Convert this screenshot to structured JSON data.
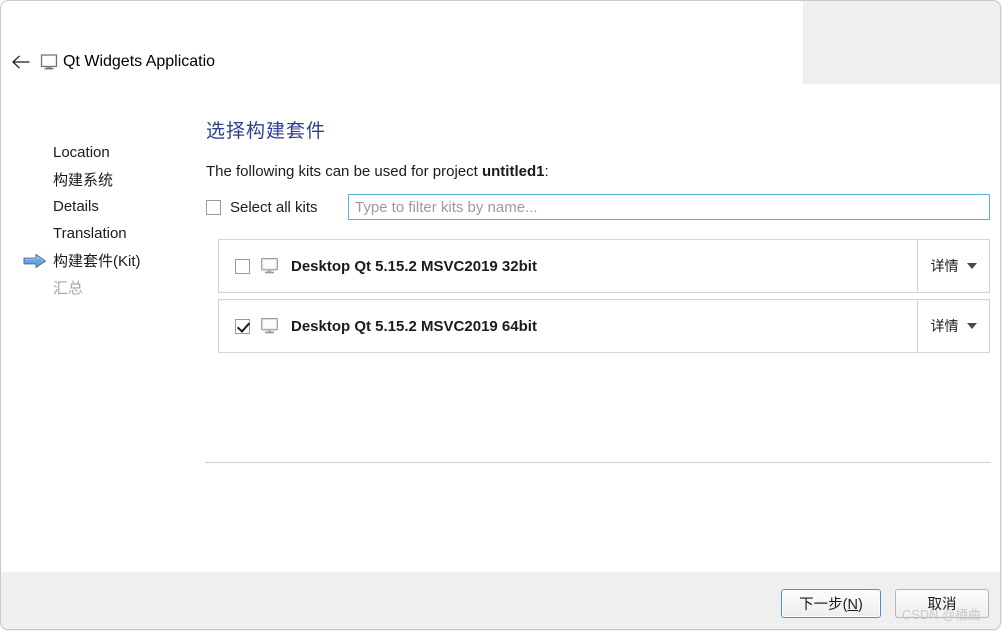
{
  "window": {
    "title": "Qt Widgets Applicatio",
    "back_icon": "back-arrow-icon",
    "app_icon": "qt-monitor-icon"
  },
  "sidebar": {
    "items": [
      {
        "label": "Location",
        "state": "done"
      },
      {
        "label": "构建系统",
        "state": "done"
      },
      {
        "label": "Details",
        "state": "done"
      },
      {
        "label": "Translation",
        "state": "done"
      },
      {
        "label": "构建套件(Kit)",
        "state": "current"
      },
      {
        "label": "汇总",
        "state": "disabled"
      }
    ],
    "current_marker_icon": "blue-right-arrow-icon"
  },
  "page": {
    "heading": "选择构建套件",
    "description_prefix": "The following kits can be used for project ",
    "description_project": "untitled1",
    "description_suffix": ":",
    "select_all_label": "Select all kits",
    "select_all_checked": false,
    "filter_placeholder": "Type to filter kits by name...",
    "filter_value": ""
  },
  "kits": [
    {
      "name": "Desktop Qt 5.15.2 MSVC2019 32bit",
      "checked": false,
      "icon": "desktop-monitor-icon",
      "details_label": "详情"
    },
    {
      "name": "Desktop Qt 5.15.2 MSVC2019 64bit",
      "checked": true,
      "icon": "desktop-monitor-icon",
      "details_label": "详情"
    }
  ],
  "footer": {
    "next_label_before": "下一步(",
    "next_mnemonic": "N",
    "next_label_after": ")",
    "cancel_label": "取消"
  },
  "watermark": "CSDN @栖曲",
  "colors": {
    "heading": "#2f3f8f",
    "focus_border": "#5aaee0",
    "default_button_border": "#4a93d4",
    "dialog_background": "#efefef",
    "content_background": "#ffffff",
    "disabled_text": "#a6a6a6"
  }
}
